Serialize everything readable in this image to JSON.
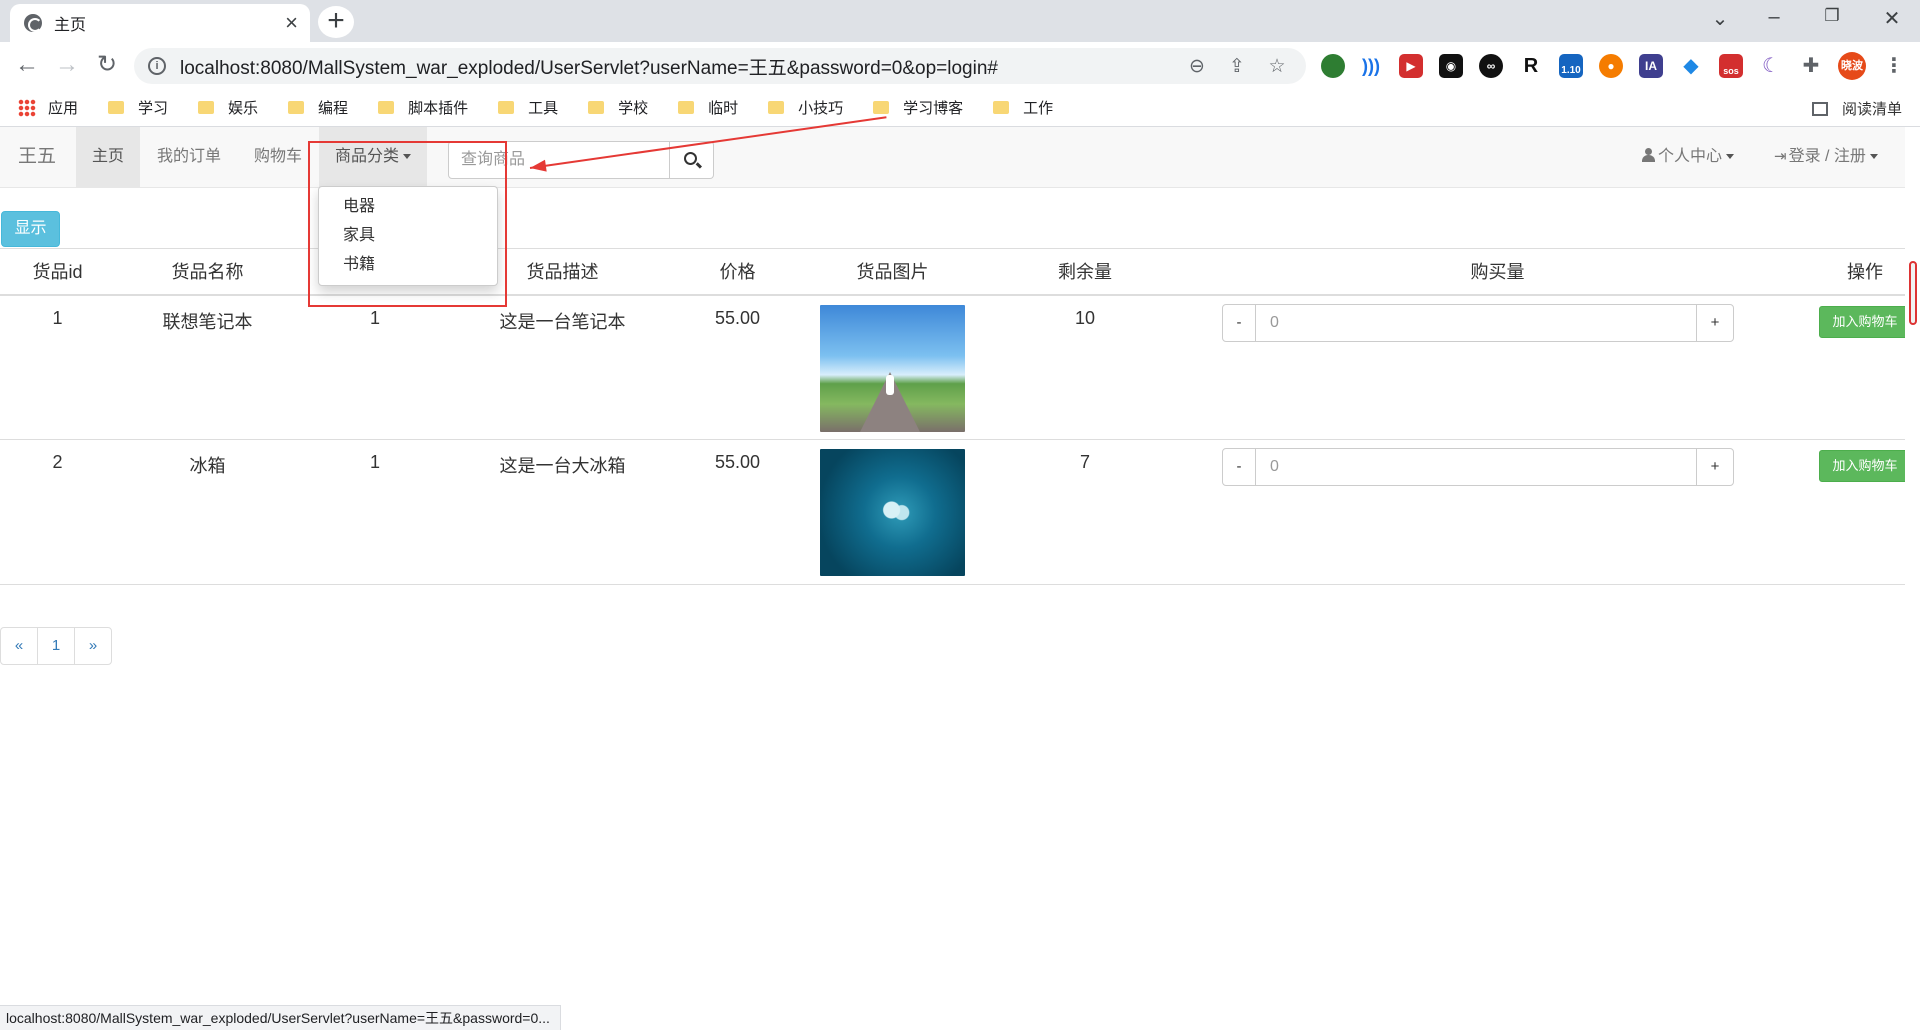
{
  "browser": {
    "tab_title": "主页",
    "url": "localhost:8080/MallSystem_war_exploded/UserServlet?userName=王五&password=0&op=login#",
    "extension_badge_version": "1.10",
    "extension_badge_sos": "sos",
    "extension_ia": "IA",
    "profile_label": "晓波",
    "bookmarks": [
      "应用",
      "学习",
      "娱乐",
      "编程",
      "脚本插件",
      "工具",
      "学校",
      "临时",
      "小技巧",
      "学习博客",
      "工作"
    ],
    "reading_list": "阅读清单",
    "status_url": "localhost:8080/MallSystem_war_exploded/UserServlet?userName=王五&password=0..."
  },
  "navbar": {
    "brand": "王五",
    "home": "主页",
    "orders": "我的订单",
    "cart": "购物车",
    "category": "商品分类",
    "search_placeholder": "查询商品",
    "user_center": "个人中心",
    "login_register": "登录 / 注册"
  },
  "dropdown": {
    "items": [
      "电器",
      "家具",
      "书籍"
    ]
  },
  "show_button": "显示",
  "table": {
    "headers": [
      "货品id",
      "货品名称",
      "",
      "货品描述",
      "价格",
      "货品图片",
      "剩余量",
      "购买量",
      "操作"
    ],
    "rows": [
      {
        "id": "1",
        "name": "联想笔记本",
        "type": "1",
        "desc": "这是一台笔记本",
        "price": "55.00",
        "image": "road-landscape-image",
        "stock": "10",
        "qty": "0",
        "action": "加入购物车"
      },
      {
        "id": "2",
        "name": "冰箱",
        "type": "1",
        "desc": "这是一台大冰箱",
        "price": "55.00",
        "image": "ocean-cloud-image",
        "stock": "7",
        "qty": "0",
        "action": "加入购物车"
      }
    ],
    "minus": "-",
    "plus": "+"
  },
  "pagination": {
    "prev": "«",
    "page": "1",
    "next": "»"
  },
  "colors": {
    "accent_info": "#5bc0de",
    "success": "#5cb85c",
    "annotation_red": "#e53935",
    "link": "#337ab7"
  }
}
